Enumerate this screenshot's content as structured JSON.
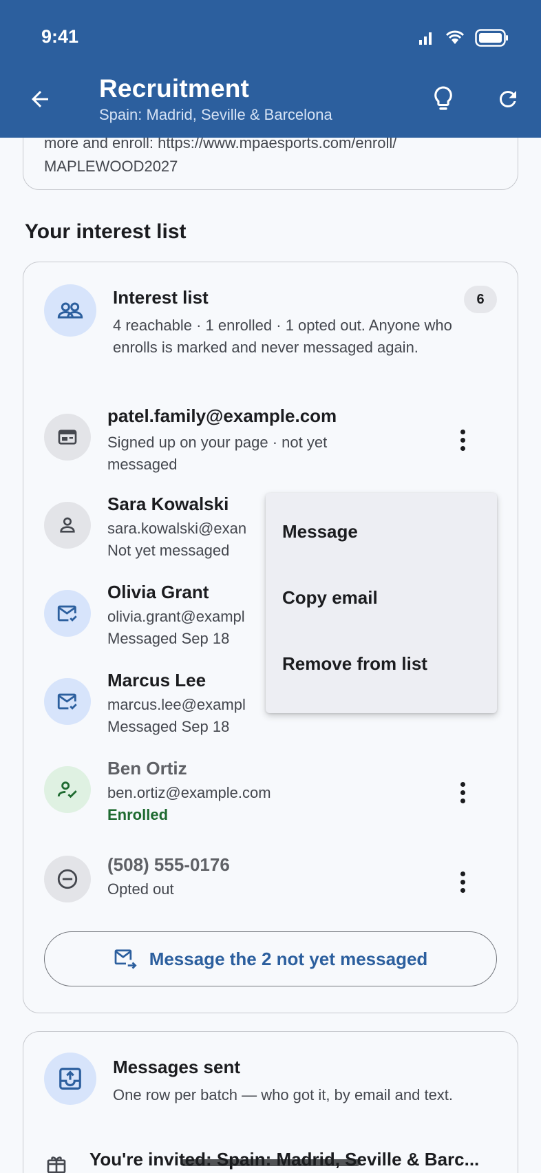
{
  "status": {
    "time": "9:41"
  },
  "header": {
    "title": "Recruitment",
    "subtitle": "Spain: Madrid, Seville & Barcelona",
    "back_icon": "arrow-back-icon",
    "actions": [
      "lightbulb-icon",
      "refresh-icon"
    ]
  },
  "previous_card": {
    "text_partial": "more and enroll: https://www.mpaesports.com/enroll/",
    "text_end": "MAPLEWOOD2027"
  },
  "interest_section": {
    "heading": "Your interest list",
    "card_title": "Interest list",
    "count": "6",
    "description": "4 reachable · 1 enrolled · 1 opted out. Anyone who enrolls is marked and never messaged again.",
    "contacts": [
      {
        "name": "patel.family@example.com",
        "line2": "Signed up on your page · not yet messaged",
        "line3": "",
        "icon": "web-form-icon"
      },
      {
        "name": "Sara Kowalski",
        "line2": "sara.kowalski@exan",
        "line3": "Not yet messaged",
        "icon": "person-icon"
      },
      {
        "name": "Olivia Grant",
        "line2": "olivia.grant@exampl",
        "line3": "Messaged Sep 18",
        "icon": "mail-check-icon"
      },
      {
        "name": "Marcus Lee",
        "line2": "marcus.lee@exampl",
        "line3": "Messaged Sep 18",
        "icon": "mail-check-icon"
      },
      {
        "name": "Ben Ortiz",
        "line2": "ben.ortiz@example.com",
        "line3": "Enrolled",
        "icon": "person-check-icon"
      },
      {
        "name": "(508) 555-0176",
        "line2": "Opted out",
        "line3": "",
        "icon": "do-not-disturb-icon"
      }
    ],
    "message_button": "Message the 2 not yet messaged"
  },
  "context_menu": {
    "items": [
      "Message",
      "Copy email",
      "Remove from list"
    ]
  },
  "messages_section": {
    "title": "Messages sent",
    "description": "One row per batch — who got it, by email and text.",
    "batch_title": "You're invited: Spain: Madrid, Seville & Barc..."
  },
  "colors": {
    "primary": "#2c5f9e",
    "enrolled_green": "#1e6a30",
    "avatar_blue": "#d7e4fb"
  }
}
